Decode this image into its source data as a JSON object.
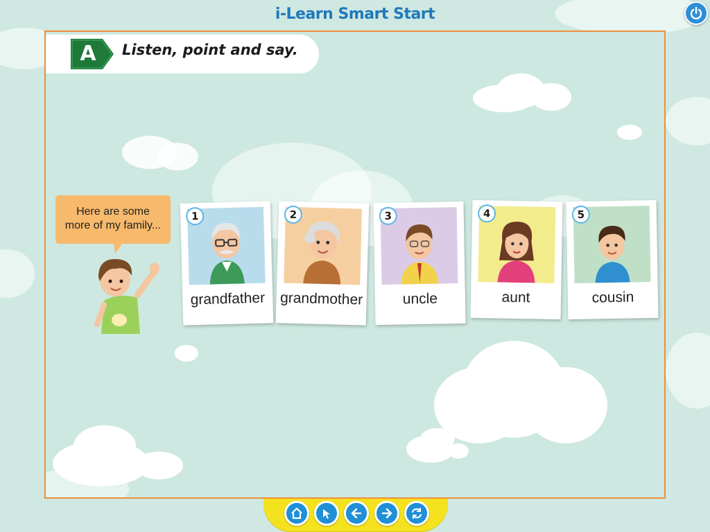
{
  "app": {
    "title": "i-Learn Smart Start"
  },
  "activity": {
    "letter": "A",
    "instruction": "Listen, point and say."
  },
  "speech": {
    "line1": "Here are some",
    "line2": "more of my family..."
  },
  "cards": [
    {
      "number": "1",
      "word": "grandfather",
      "bg": "#b9dcec",
      "icon": "grandfather-icon"
    },
    {
      "number": "2",
      "word": "grandmother",
      "bg": "#f6cfa0",
      "icon": "grandmother-icon"
    },
    {
      "number": "3",
      "word": "uncle",
      "bg": "#dccbe6",
      "icon": "uncle-icon"
    },
    {
      "number": "4",
      "word": "aunt",
      "bg": "#f3ec8c",
      "icon": "aunt-icon"
    },
    {
      "number": "5",
      "word": "cousin",
      "bg": "#bfe0c7",
      "icon": "cousin-icon"
    }
  ],
  "toolbar": {
    "buttons": [
      "home-icon",
      "cursor-icon",
      "back-arrow-icon",
      "forward-arrow-icon",
      "refresh-icon"
    ]
  },
  "colors": {
    "title": "#1f79b8",
    "frame_border": "#ee8f3b",
    "tag_green": "#1f7a3a",
    "speech_bubble": "#f7b96b",
    "toolbar": "#f5e21e",
    "button_blue": "#1f8fd8"
  }
}
